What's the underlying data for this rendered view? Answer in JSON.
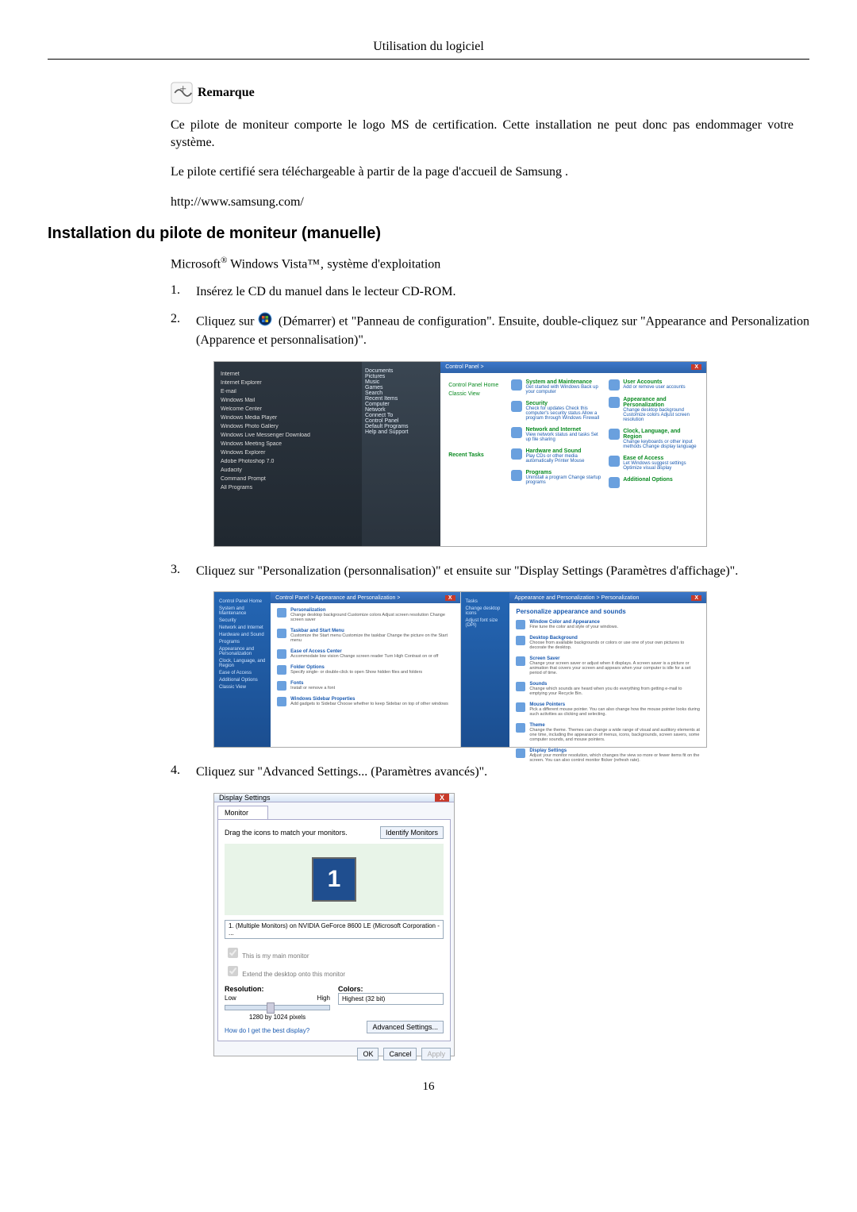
{
  "header": {
    "title": "Utilisation du logiciel"
  },
  "note": {
    "label": "Remarque",
    "para1": "Ce pilote de moniteur comporte le logo MS de certification. Cette installation ne peut donc pas endommager votre système.",
    "para2": "Le pilote certifié sera téléchargeable à partir de la page d'accueil de Samsung .",
    "url": "http://www.samsung.com/"
  },
  "section": {
    "title": "Installation du pilote de moniteur (manuelle)",
    "subline_pre": "Microsoft",
    "subline_reg": "®",
    "subline_rest": " Windows Vista™‚ système d'exploitation"
  },
  "steps": {
    "s1": {
      "num": "1.",
      "text": "Insérez le CD du manuel dans le lecteur CD-ROM."
    },
    "s2": {
      "num": "2.",
      "pre": "Cliquez sur",
      "post": "(Démarrer) et \"Panneau de configuration\". Ensuite, double-cliquez sur \"Appearance and Personalization (Apparence et personnalisation)\"."
    },
    "s3": {
      "num": "3.",
      "text": "Cliquez sur \"Personalization (personnalisation)\" et ensuite sur \"Display Settings (Paramètres d'affichage)\"."
    },
    "s4": {
      "num": "4.",
      "text": "Cliquez sur \"Advanced Settings... (Paramètres avancés)\"."
    }
  },
  "shot1": {
    "start_menu": [
      "Internet",
      "Internet Explorer",
      "E-mail",
      "Windows Mail",
      "Welcome Center",
      "Windows Media Player",
      "Windows Photo Gallery",
      "Windows Live Messenger Download",
      "Windows Meeting Space",
      "Windows Explorer",
      "Adobe Photoshop 7.0",
      "Audacity",
      "Command Prompt",
      "All Programs"
    ],
    "right_col": [
      "Documents",
      "Pictures",
      "Music",
      "Games",
      "Search",
      "Recent Items",
      "Computer",
      "Network",
      "Connect To",
      "Control Panel",
      "Default Programs",
      "Help and Support"
    ],
    "cp_path": "Control Panel >",
    "cp_side": [
      "Control Panel Home",
      "Classic View"
    ],
    "cp_recent": "Recent Tasks",
    "cp_items": [
      {
        "head": "System and Maintenance",
        "sub": "Get started with Windows  Back up your computer"
      },
      {
        "head": "Security",
        "sub": "Check for updates  Check this computer's security status  Allow a program through Windows Firewall"
      },
      {
        "head": "Network and Internet",
        "sub": "View network status and tasks  Set up file sharing"
      },
      {
        "head": "Hardware and Sound",
        "sub": "Play CDs or other media automatically  Printer  Mouse"
      },
      {
        "head": "Programs",
        "sub": "Uninstall a program  Change startup programs"
      },
      {
        "head": "User Accounts",
        "sub": "Add or remove user accounts"
      },
      {
        "head": "Appearance and Personalization",
        "sub": "Change desktop background  Customize colors  Adjust screen resolution"
      },
      {
        "head": "Clock, Language, and Region",
        "sub": "Change keyboards or other input methods  Change display language"
      },
      {
        "head": "Ease of Access",
        "sub": "Let Windows suggest settings  Optimize visual display"
      },
      {
        "head": "Additional Options",
        "sub": ""
      }
    ]
  },
  "shot2": {
    "left_path": "Control Panel > Appearance and Personalization >",
    "left_side": [
      "Control Panel Home",
      "System and Maintenance",
      "Security",
      "Network and Internet",
      "Hardware and Sound",
      "Programs",
      "Appearance and Personalization",
      "Clock, Language, and Region",
      "Ease of Access",
      "Additional Options",
      "Classic View"
    ],
    "left_items": [
      {
        "t": "Personalization",
        "d": "Change desktop background  Customize colors  Adjust screen resolution  Change screen saver"
      },
      {
        "t": "Taskbar and Start Menu",
        "d": "Customize the Start menu  Customize the taskbar  Change the picture on the Start menu"
      },
      {
        "t": "Ease of Access Center",
        "d": "Accommodate low vision  Change screen reader  Turn High Contrast on or off"
      },
      {
        "t": "Folder Options",
        "d": "Specify single- or double-click to open  Show hidden files and folders"
      },
      {
        "t": "Fonts",
        "d": "Install or remove a font"
      },
      {
        "t": "Windows Sidebar Properties",
        "d": "Add gadgets to Sidebar  Choose whether to keep Sidebar on top of other windows"
      }
    ],
    "right_path": "Appearance and Personalization > Personalization",
    "right_side": [
      "Tasks",
      "Change desktop icons",
      "Adjust font size (DPI)"
    ],
    "right_head": "Personalize appearance and sounds",
    "right_items": [
      {
        "t": "Window Color and Appearance",
        "d": "Fine tune the color and style of your windows."
      },
      {
        "t": "Desktop Background",
        "d": "Choose from available backgrounds or colors or use one of your own pictures to decorate the desktop."
      },
      {
        "t": "Screen Saver",
        "d": "Change your screen saver or adjust when it displays. A screen saver is a picture or animation that covers your screen and appears when your computer is idle for a set period of time."
      },
      {
        "t": "Sounds",
        "d": "Change which sounds are heard when you do everything from getting e-mail to emptying your Recycle Bin."
      },
      {
        "t": "Mouse Pointers",
        "d": "Pick a different mouse pointer. You can also change how the mouse pointer looks during such activities as clicking and selecting."
      },
      {
        "t": "Theme",
        "d": "Change the theme. Themes can change a wide range of visual and auditory elements at one time, including the appearance of menus, icons, backgrounds, screen savers, some computer sounds, and mouse pointers."
      },
      {
        "t": "Display Settings",
        "d": "Adjust your monitor resolution, which changes the view so more or fewer items fit on the screen. You can also control monitor flicker (refresh rate)."
      }
    ]
  },
  "ds": {
    "title": "Display Settings",
    "tab": "Monitor",
    "drag": "Drag the icons to match your monitors.",
    "identify": "Identify Monitors",
    "monitor_num": "1",
    "combo": "1. (Multiple Monitors) on NVIDIA GeForce 8600 LE (Microsoft Corporation - ...",
    "chk1": "This is my main monitor",
    "chk2": "Extend the desktop onto this monitor",
    "res_label": "Resolution:",
    "low": "Low",
    "high": "High",
    "res_current": "1280 by 1024 pixels",
    "colors_label": "Colors:",
    "colors_val": "Highest (32 bit)",
    "help_link": "How do I get the best display?",
    "adv": "Advanced Settings...",
    "ok": "OK",
    "cancel": "Cancel",
    "apply": "Apply"
  },
  "page_num": "16"
}
